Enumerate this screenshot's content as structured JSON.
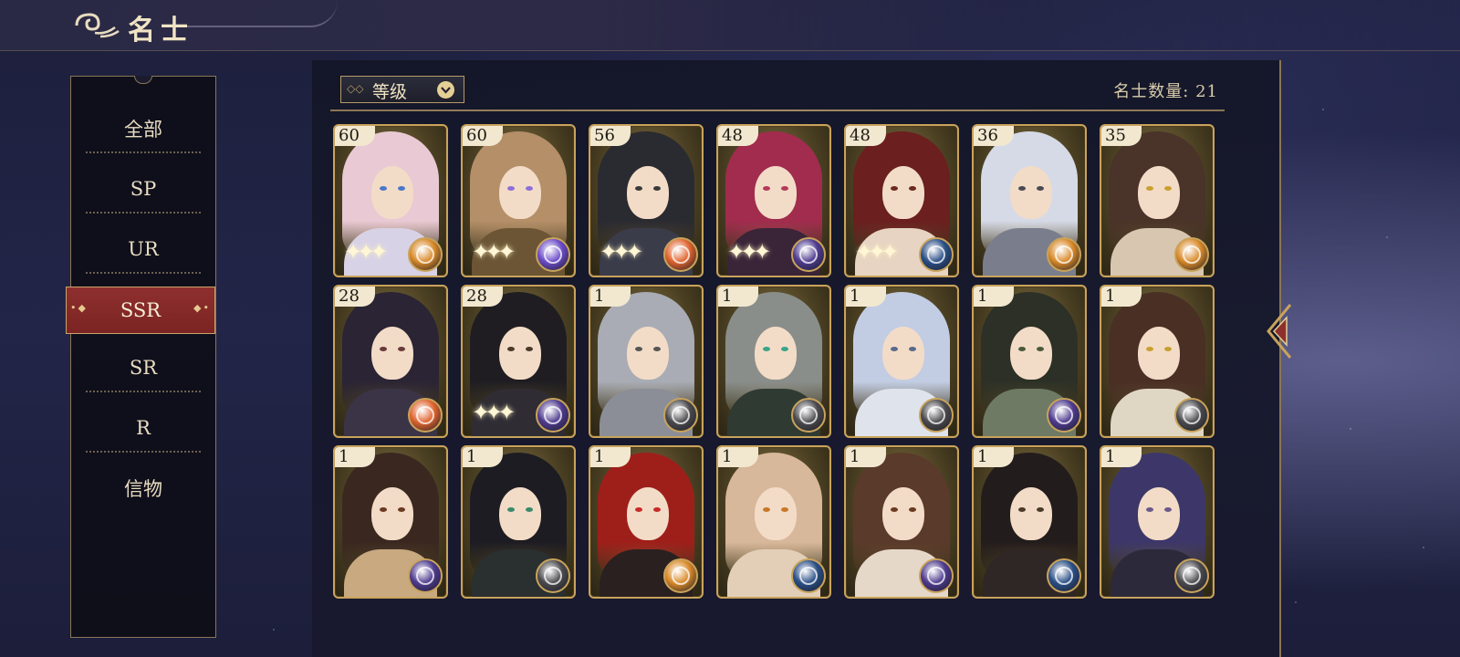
{
  "header": {
    "title": "名士"
  },
  "sidebar": {
    "items": [
      {
        "label": "全部"
      },
      {
        "label": "SP"
      },
      {
        "label": "UR"
      },
      {
        "label": "SSR"
      },
      {
        "label": "SR"
      },
      {
        "label": "R"
      },
      {
        "label": "信物"
      }
    ],
    "selected": "SSR"
  },
  "toolbar": {
    "sort_label": "等级",
    "count_label": "名士数量: 21"
  },
  "colors": {
    "active_tab": "#8e2f2e",
    "card_border": "#c8a35b",
    "accent_gold": "#b59a69"
  },
  "cards": [
    {
      "level": "60",
      "element": "fire-gold-orb-icon",
      "hair": "#e9c9d3",
      "body": "#d8d2e6",
      "eye": "#4a78c8",
      "orb": "#d98a2a",
      "sparkles": true
    },
    {
      "level": "60",
      "element": "cosmic-orb-icon",
      "hair": "#b48f68",
      "body": "#6b5534",
      "eye": "#8e6fd8",
      "orb": "#6a4bc8",
      "sparkles": true
    },
    {
      "level": "56",
      "element": "fire-orb-icon",
      "hair": "#2a2a31",
      "body": "#3a3c4a",
      "eye": "#3a3a3a",
      "orb": "#e0642f",
      "sparkles": true
    },
    {
      "level": "48",
      "element": "moon-orb-icon",
      "hair": "#a12c4e",
      "body": "#3a2438",
      "eye": "#b33a5a",
      "orb": "#4e3b8e",
      "sparkles": true
    },
    {
      "level": "48",
      "element": "cloud-orb-icon",
      "hair": "#6b1f1f",
      "body": "#e7d4c3",
      "eye": "#6a2a22",
      "orb": "#2a4f86",
      "sparkles": true
    },
    {
      "level": "36",
      "element": "fire-gold-orb-icon",
      "hair": "#d6dae6",
      "body": "#7a7e8c",
      "eye": "#4a4a55",
      "orb": "#d98a2a",
      "sparkles": false
    },
    {
      "level": "35",
      "element": "fire-gold-orb-icon",
      "hair": "#4a3328",
      "body": "#d8c6b0",
      "eye": "#c8a032",
      "orb": "#d98a2a",
      "sparkles": false
    },
    {
      "level": "28",
      "element": "fire-orb-icon",
      "hair": "#2a2434",
      "body": "#3b3446",
      "eye": "#6a3a3a",
      "orb": "#e0642f",
      "sparkles": false
    },
    {
      "level": "28",
      "element": "moon-orb-icon",
      "hair": "#1f1d22",
      "body": "#2f2c34",
      "eye": "#4a3a2a",
      "orb": "#4e3b8e",
      "sparkles": true
    },
    {
      "level": "1",
      "element": "cloud-orb-icon",
      "hair": "#a9acb4",
      "body": "#8b8e97",
      "eye": "#555",
      "orb": "#4a4a4e",
      "sparkles": false
    },
    {
      "level": "1",
      "element": "cloud-orb-icon",
      "hair": "#8a8e8a",
      "body": "#2f3a32",
      "eye": "#3aa58a",
      "orb": "#4a4a4e",
      "sparkles": false
    },
    {
      "level": "1",
      "element": "cloud-orb-icon",
      "hair": "#c2cde4",
      "body": "#dfe3ec",
      "eye": "#5a6a8a",
      "orb": "#4a4a4e",
      "sparkles": false
    },
    {
      "level": "1",
      "element": "moon-orb-icon",
      "hair": "#2c3026",
      "body": "#6e7a64",
      "eye": "#4a5a3a",
      "orb": "#4e3b8e",
      "sparkles": false
    },
    {
      "level": "1",
      "element": "cloud-orb-icon",
      "hair": "#4a2f24",
      "body": "#e0d6c4",
      "eye": "#c8a032",
      "orb": "#4a4a4e",
      "sparkles": false
    },
    {
      "level": "1",
      "element": "moon-orb-icon",
      "hair": "#3a2820",
      "body": "#c8a980",
      "eye": "#6a3a22",
      "orb": "#4e3b8e",
      "sparkles": false
    },
    {
      "level": "1",
      "element": "cloud-orb-icon",
      "hair": "#1d1c22",
      "body": "#2a2f30",
      "eye": "#3a8a6a",
      "orb": "#4a4a4e",
      "sparkles": false
    },
    {
      "level": "1",
      "element": "fire-gold-orb-icon",
      "hair": "#9e1f1a",
      "body": "#2a2020",
      "eye": "#c82a2a",
      "orb": "#d98a2a",
      "sparkles": false
    },
    {
      "level": "1",
      "element": "cloud-orb-icon",
      "hair": "#d8b89a",
      "body": "#e3cfb8",
      "eye": "#c8782a",
      "orb": "#2a4f86",
      "sparkles": false
    },
    {
      "level": "1",
      "element": "moon-orb-icon",
      "hair": "#5a3a2a",
      "body": "#e6d8c8",
      "eye": "#6a3a22",
      "orb": "#4e3b8e",
      "sparkles": false
    },
    {
      "level": "1",
      "element": "cloud-orb-icon",
      "hair": "#231c1c",
      "body": "#2f2626",
      "eye": "#4a3a2a",
      "orb": "#2a4f86",
      "sparkles": false
    },
    {
      "level": "1",
      "element": "cloud-orb-icon",
      "hair": "#3c3768",
      "body": "#2c2a3a",
      "eye": "#6a5a8a",
      "orb": "#4a4a4e",
      "sparkles": false
    }
  ]
}
